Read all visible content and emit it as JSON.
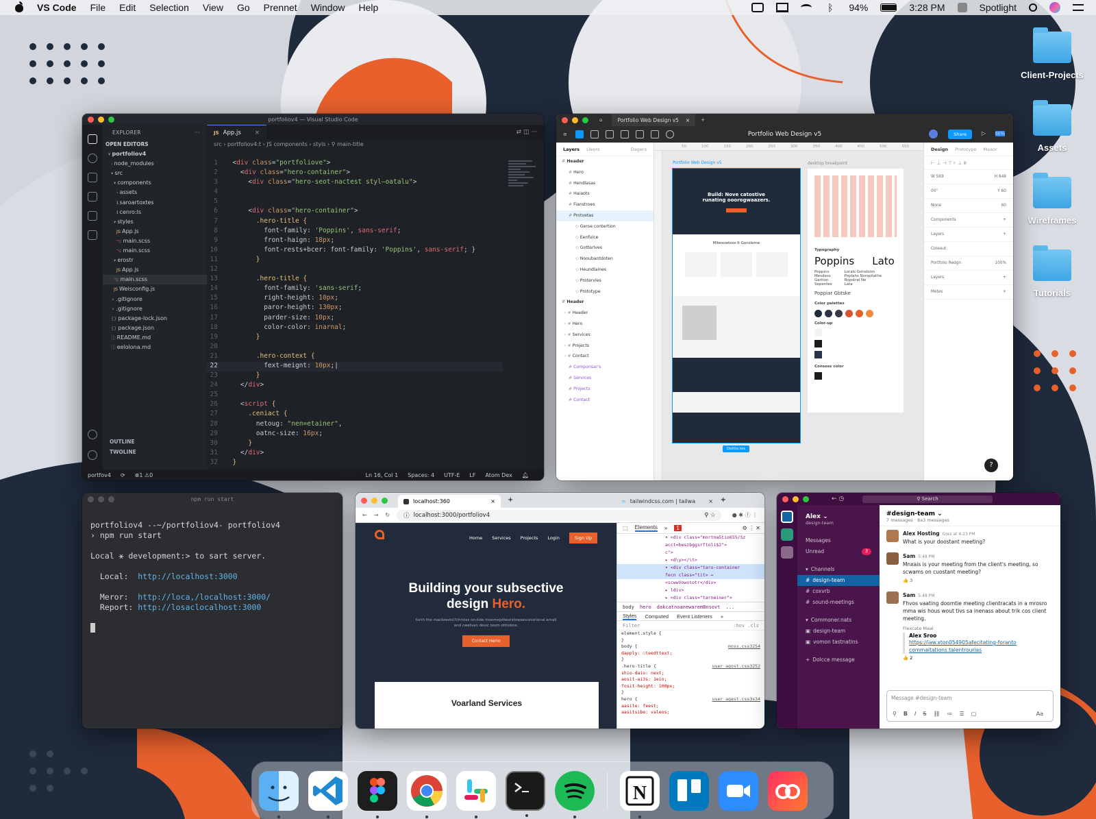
{
  "menubar": {
    "app": "VS Code",
    "menus": [
      "File",
      "Edit",
      "Selection",
      "View",
      "Go",
      "Prennet",
      "Window",
      "Help"
    ],
    "battery": "94%",
    "battery_level": 0.94,
    "time": "3:28 PM",
    "spotlight": "Spotlight"
  },
  "desktop": {
    "folders": [
      "Client-Projects",
      "Assets",
      "Wireframes",
      "Tutorials"
    ]
  },
  "vscode": {
    "title": "portfoliov4 — Visual Studio Code",
    "explorer_label": "EXPLORER",
    "open_editors": "OPEN EDITORS",
    "tab": "App.js",
    "breadcrumb": "src › portfoliov4:t › JS components › styls › ⚲ main-title",
    "tree": [
      "portfoliov4",
      "node_modules",
      "src",
      "components",
      "assets",
      "saroartoxtes",
      "cenro:ls",
      "styles",
      "App.js",
      "main.scss",
      "main.scss",
      "erostr",
      "App.js",
      "main.scss",
      "Weisconfig.js",
      ".gitignore",
      ".gitignore",
      "package-lock.json",
      "package.json",
      "README.md",
      "eelolona.md"
    ],
    "outline": "OUTLINE",
    "timeline": "TWOLINE",
    "status": {
      "branch": "portfov4",
      "problems": "⊗1 ⚠0",
      "position": "Ln 16, Col 1",
      "spaces": "Spaces: 4",
      "encoding": "UTF-E",
      "eol": "LF",
      "theme": "Atom Dex"
    }
  },
  "figma": {
    "tab": "Portfolio Web Design v5",
    "file_title": "Portfolio Web Design v5",
    "share": "Share",
    "zoom": "00%",
    "layer_tabs": [
      "Layers",
      "Lleors",
      "Dagers"
    ],
    "layers": [
      "Header",
      "Hero",
      "Hendlasas",
      "Haiaots",
      "Fianstroes",
      "Protvetas",
      "Gerse contertion",
      "Eenfulce",
      "Gotterlves",
      "Nooubantdoten",
      "Heundlaines",
      "Protervles",
      "Prototype",
      "Header",
      "Header",
      "Hero",
      "Services",
      "Projects",
      "Contact",
      "Componsar's",
      "Services",
      "Projects",
      "Contact"
    ],
    "frame_label": "Portfolio Web Design v5",
    "breakpoint_label": "desktop breakpoint",
    "frame_hero_text": "Build: Nove catostive runating ooorogwaazers.",
    "frame_section_title": "Mileoowtoss It Gonsleme",
    "typography_label": "Typography",
    "font_a": "Poppins",
    "font_b": "Lato",
    "font_a_styles": [
      "Poppins",
      "Mesdess",
      "Garlton",
      "Sepentes"
    ],
    "font_b_styles": [
      "Lorals Gonslorm",
      "Poplahs Nsropilathe",
      "Ropstral Ne",
      "Lata"
    ],
    "popper": "Poppiar Gbtske",
    "palette_label": "Color palettes",
    "palette": [
      "#1f2a3a",
      "#2a3446",
      "#333a44",
      "#d9532c",
      "#e8612c",
      "#f08a3c"
    ],
    "colorup_label": "Color-up",
    "consos_label": "Consoss color",
    "frame_badge": "Dottle.tos",
    "prop_tabs": [
      "Design",
      "Prototype",
      "Maaor"
    ],
    "props": [
      [
        "W 569",
        "H 848"
      ],
      [
        "00°",
        "Y 60"
      ],
      [
        "None",
        "60"
      ],
      [
        "Components",
        "+"
      ],
      [
        "Layers",
        "+"
      ],
      [
        "Coleaut",
        ""
      ],
      [
        "Portfolio Redgn",
        "100%"
      ],
      [
        "Layers",
        "+"
      ],
      [
        "Metes",
        "+"
      ]
    ],
    "help": "?"
  },
  "terminal": {
    "title": "npm run start",
    "lines": [
      "portfoliov4 --~/portfoliov4- portfoliov4",
      "› npm run start",
      "",
      "Local ⚹ development:> to sart server.",
      ""
    ],
    "local_label": "  Local:  ",
    "local_url": "http://localhost:3000",
    "meror_label": "  Meror:  ",
    "meror_url": "http://loca,/localhost:3000/",
    "report_label": "  Report: ",
    "report_url": "http://losaclocalhost:3000"
  },
  "chrome": {
    "tab1": "localhost:360",
    "tab2": "tailwindcss.com | tailwa",
    "url": "localhost:3000/portfoliov4",
    "nav": [
      "Home",
      "Services",
      "Projects",
      "Login"
    ],
    "signup": "Sign Up",
    "hero_line1": "Building your subsective",
    "hero_line2a": "design ",
    "hero_line2b": "Hero.",
    "hero_sub": "furth the macbrestxi?chrioss on-tide moomspdlwsrstoweevunorional email and cwetvan desic tesm ottisloos.",
    "hero_button": "Contact Herro",
    "services_title": "Voarland Services",
    "devtools_tabs": [
      "Elements",
      "»"
    ],
    "errors": "1",
    "dom": [
      "▾ <div class=\"mortna5tio655/Sz",
      "acct=beszbggsrftoli$2\">",
      "c\">",
      "▸ <d\\y></\\t>",
      "▾ <div class=\"taru-container",
      "fecn class=\"tit> ↔",
      "<scwwVowototr</div>",
      "▸ ldiv>",
      "▸ <div class=\"tarneiner\">"
    ],
    "crumbs": [
      "body",
      "hero",
      "dakcatnoanewaremBnsovt",
      "..."
    ],
    "styles_tabs": [
      "Styles",
      "Computed",
      "Event Listeners",
      "»"
    ],
    "filter": "Filter",
    "hov": ":hov .cls",
    "rules": [
      [
        "element.style {",
        ""
      ],
      [
        "}",
        ""
      ],
      [
        "body {",
        "moss.css3254"
      ],
      [
        "  dapply: ☐teedttext;",
        ""
      ],
      [
        "}",
        ""
      ],
      [
        ".hero-title {",
        "user agost.css3252"
      ],
      [
        "  shio-daio: next;",
        ""
      ],
      [
        "  aosit-ai3s: 1eio;",
        ""
      ],
      [
        "  fosit-height: 100px;",
        ""
      ],
      [
        "}",
        ""
      ],
      [
        "hero {",
        "user agest.css3s34"
      ],
      [
        "  aasile: feest;",
        ""
      ],
      [
        "  aasitsibe: valeos;",
        ""
      ]
    ]
  },
  "slack": {
    "search": "Search",
    "workspace": "Alex",
    "workspace_sub": "design-team",
    "nav": [
      "Messages",
      "Unread"
    ],
    "unread": "3",
    "channels_label": "Channels",
    "channels": [
      "design-team",
      "coxvrb",
      "sound-meetings"
    ],
    "commons_label": "Commoner.nats",
    "commons": [
      "design-team",
      "vomon tastnatins"
    ],
    "dolce": "Dolcce message",
    "channel": "#design-team",
    "channel_sub": "7 messages · 8a3 messages",
    "messages": [
      {
        "name": "Alex Hosting",
        "time": "Gres at 4:23 PM",
        "text": "What is your doostant meeting?",
        "reaction": ""
      },
      {
        "name": "Sam",
        "time": "5:48 PM",
        "text": "Mnxais is your meeting from the client's meeting, so scwams on cuostant meeting?",
        "reaction": "👍 3"
      },
      {
        "name": "Sam",
        "time": "5:48 PM",
        "text": "Fhvos vaating doomtie meeting clientracats in a mrosro mma wis hous wout tivs sa inenass about trik cos client meeting.",
        "reaction": ""
      }
    ],
    "flexcate": "Flexcate Maal",
    "quote_name": "Alex Sroo",
    "quote_link": "https://iaw.xton054905afecitating-foranto commaitations.talentrourias",
    "reaction2": "👍 2",
    "compose": "Message #design-team",
    "compose_aa": "Aa"
  },
  "dock": [
    "Finder",
    "Visual Studio Code",
    "Figma",
    "Google Chrome",
    "Slack",
    "Terminal",
    "Spotify",
    "Notion",
    "Trello",
    "Zoom",
    "Creative Cloud"
  ]
}
